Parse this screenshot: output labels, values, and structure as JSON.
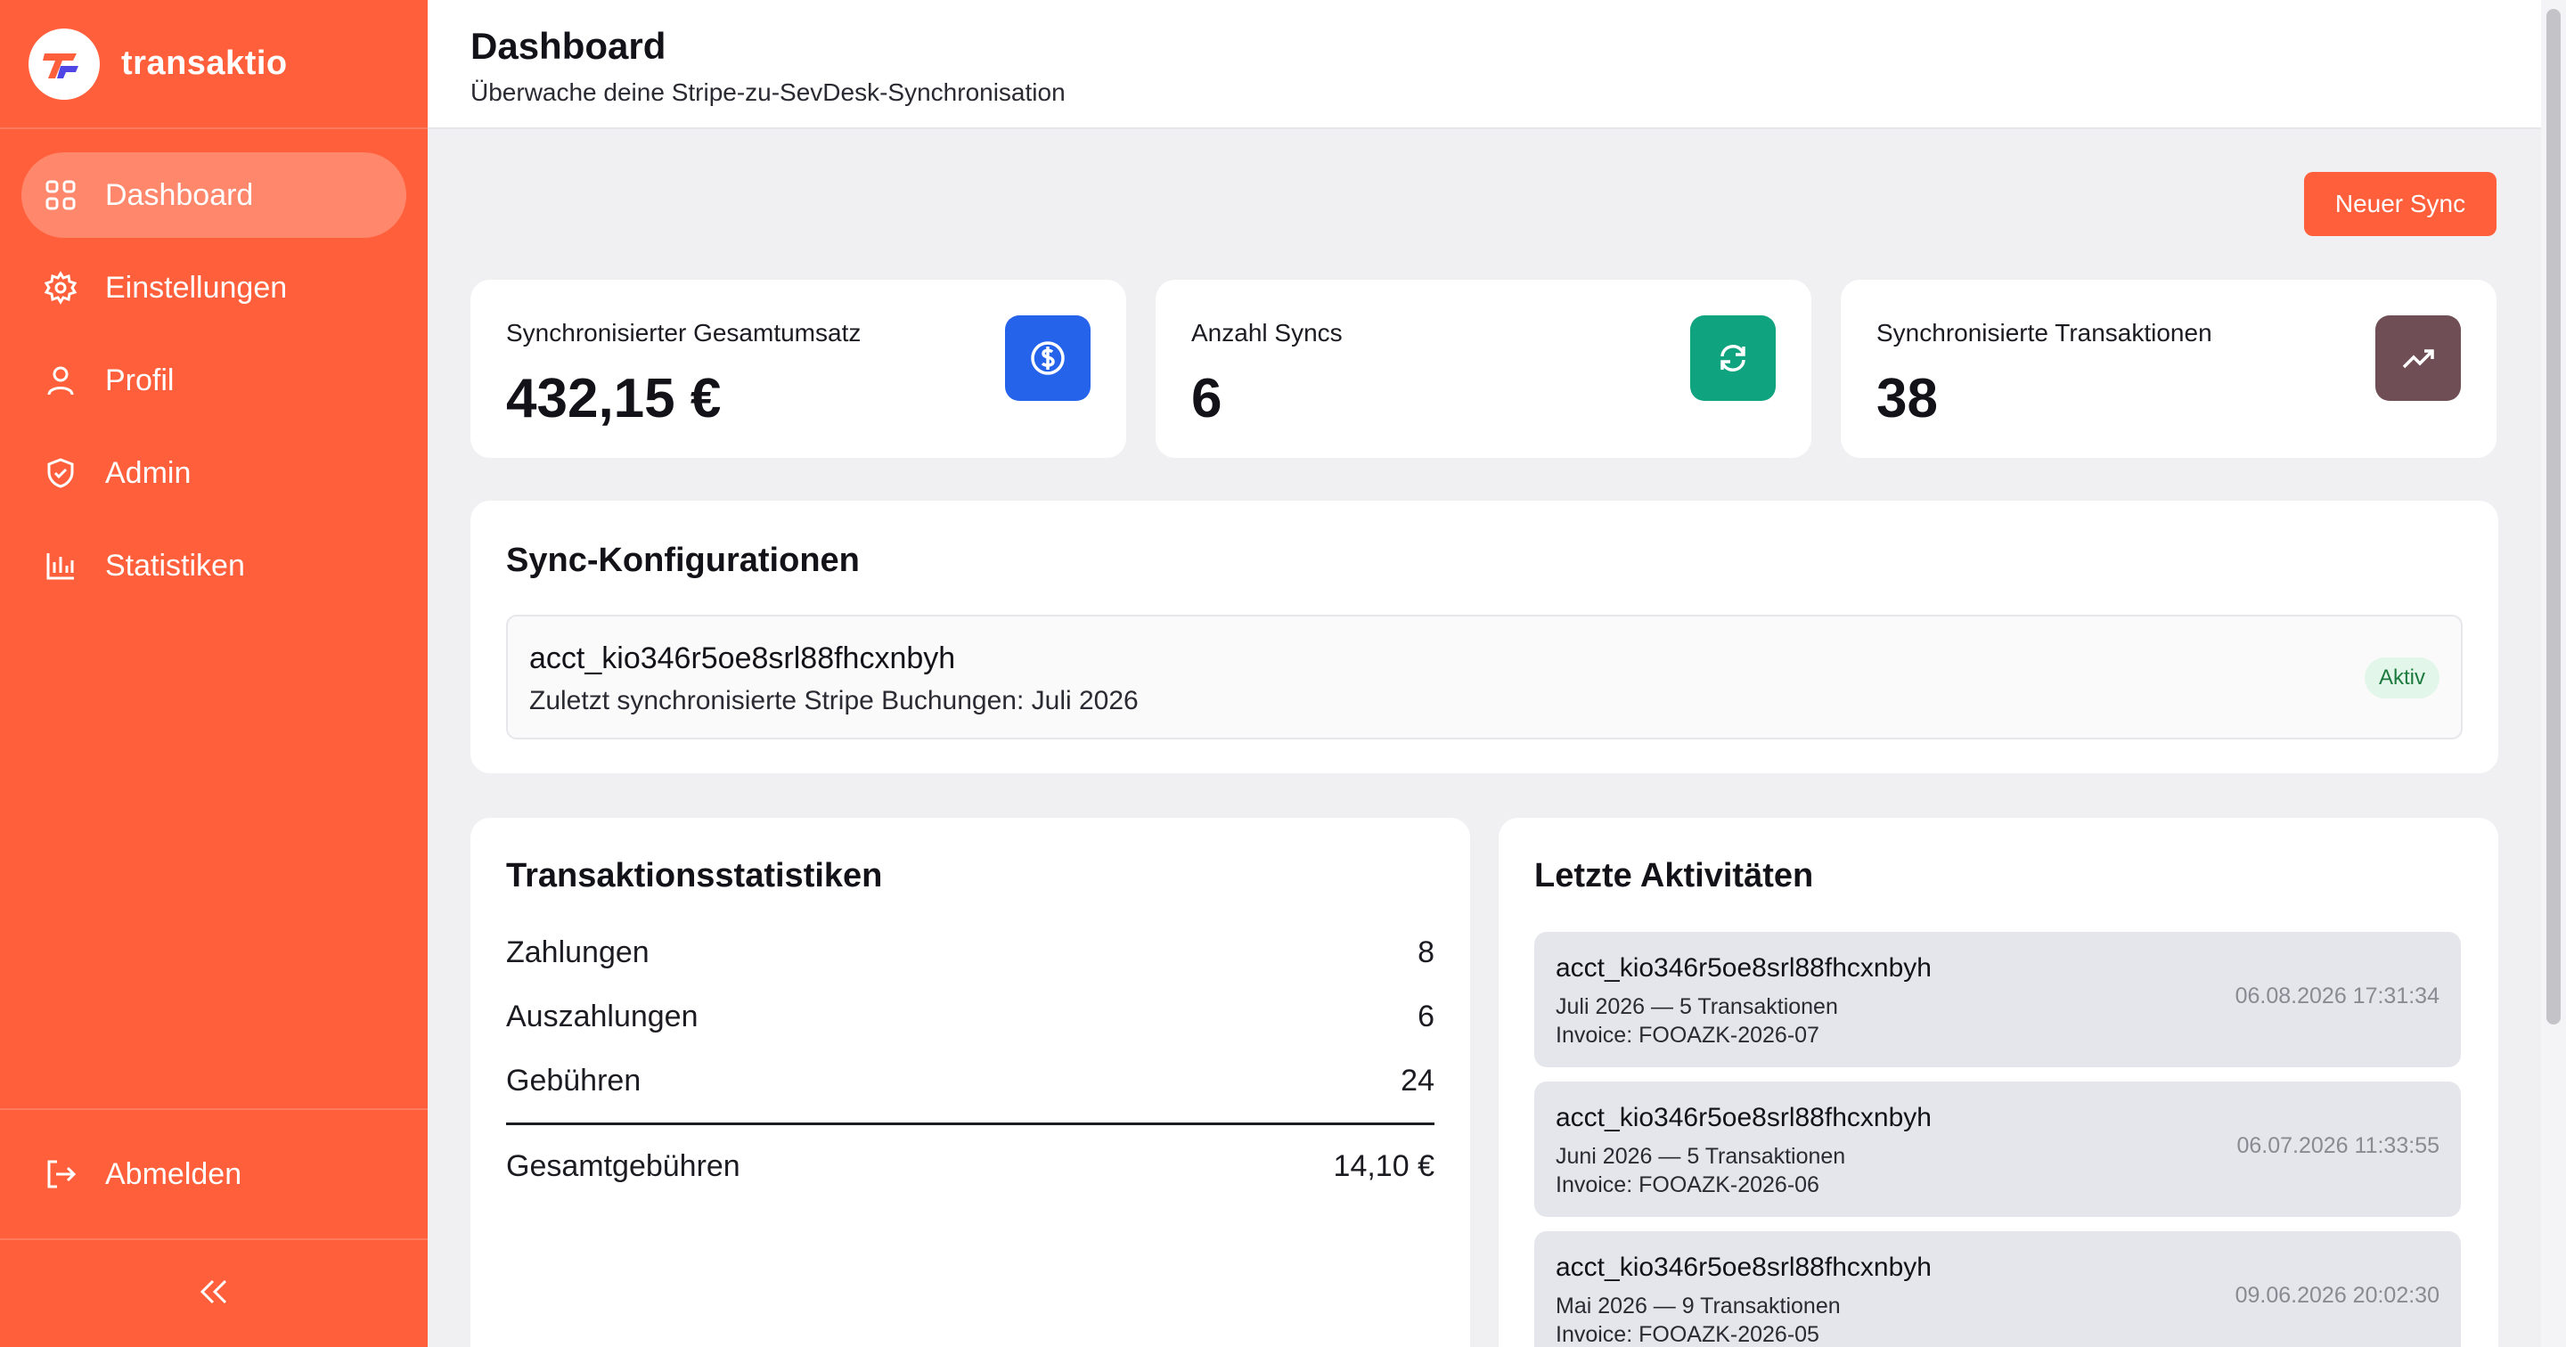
{
  "app": {
    "name": "transaktio"
  },
  "colors": {
    "accent": "#ff5f3a",
    "stat_blue": "#2563eb",
    "stat_green": "#10a37f",
    "stat_brown": "#6f4e55",
    "badge_green": "#1d7a3e"
  },
  "sidebar": {
    "items": [
      {
        "label": "Dashboard",
        "icon": "grid-icon",
        "active": true
      },
      {
        "label": "Einstellungen",
        "icon": "gear-icon",
        "active": false
      },
      {
        "label": "Profil",
        "icon": "user-icon",
        "active": false
      },
      {
        "label": "Admin",
        "icon": "shield-icon",
        "active": false
      },
      {
        "label": "Statistiken",
        "icon": "bar-chart-icon",
        "active": false
      }
    ],
    "logout_label": "Abmelden"
  },
  "header": {
    "title": "Dashboard",
    "subtitle": "Überwache deine Stripe-zu-SevDesk-Synchronisation"
  },
  "actions": {
    "new_sync_label": "Neuer Sync"
  },
  "stats": [
    {
      "label": "Synchronisierter Gesamtumsatz",
      "value": "432,15 €",
      "icon": "dollar-icon"
    },
    {
      "label": "Anzahl Syncs",
      "value": "6",
      "icon": "refresh-icon"
    },
    {
      "label": "Synchronisierte Transaktionen",
      "value": "38",
      "icon": "trending-up-icon"
    }
  ],
  "sync_configs": {
    "title": "Sync-Konfigurationen",
    "items": [
      {
        "account": "acct_kio346r5oe8srl88fhcxnbyh",
        "description": "Zuletzt synchronisierte Stripe Buchungen: Juli 2026",
        "status": "Aktiv"
      }
    ]
  },
  "transaction_stats": {
    "title": "Transaktionsstatistiken",
    "rows": [
      {
        "label": "Zahlungen",
        "value": "8"
      },
      {
        "label": "Auszahlungen",
        "value": "6"
      },
      {
        "label": "Gebühren",
        "value": "24"
      }
    ],
    "total": {
      "label": "Gesamtgebühren",
      "value": "14,10 €"
    }
  },
  "recent_activity": {
    "title": "Letzte Aktivitäten",
    "items": [
      {
        "account": "acct_kio346r5oe8srl88fhcxnbyh",
        "summary": "Juli 2026 — 5 Transaktionen",
        "invoice": "Invoice: FOOAZK-2026-07",
        "timestamp": "06.08.2026 17:31:34"
      },
      {
        "account": "acct_kio346r5oe8srl88fhcxnbyh",
        "summary": "Juni 2026 — 5 Transaktionen",
        "invoice": "Invoice: FOOAZK-2026-06",
        "timestamp": "06.07.2026 11:33:55"
      },
      {
        "account": "acct_kio346r5oe8srl88fhcxnbyh",
        "summary": "Mai 2026 — 9 Transaktionen",
        "invoice": "Invoice: FOOAZK-2026-05",
        "timestamp": "09.06.2026 20:02:30"
      }
    ]
  }
}
